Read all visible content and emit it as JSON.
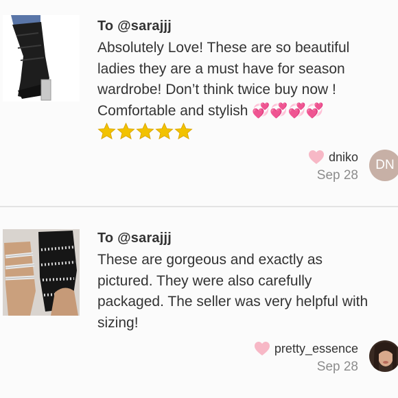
{
  "reviews": [
    {
      "to": "To @sarajjj",
      "body": "Absolutely Love! These are so beautiful\nladies they are a must have for season\nwardrobe! Don’t think twice buy now !\nComfortable and stylish 💞💞💞💞",
      "stars": 5,
      "author": "dniko",
      "date": "Sep 28",
      "avatar_initials": "DN",
      "avatar_color": "#c7b0a6",
      "product_image": "black-knee-high-boot"
    },
    {
      "to": "To @sarajjj",
      "body": "These are gorgeous and exactly as\npictured. They were also carefully\npackaged. The seller was very helpful with\nsizing!",
      "author": "pretty_essence",
      "date": "Sep 28",
      "avatar_initials": "",
      "product_image": "studded-sandals"
    }
  ],
  "colors": {
    "heart": "#f7b8c6",
    "star": "#f2c200",
    "date": "#8c8c8c",
    "divider": "#e3e3e3"
  }
}
